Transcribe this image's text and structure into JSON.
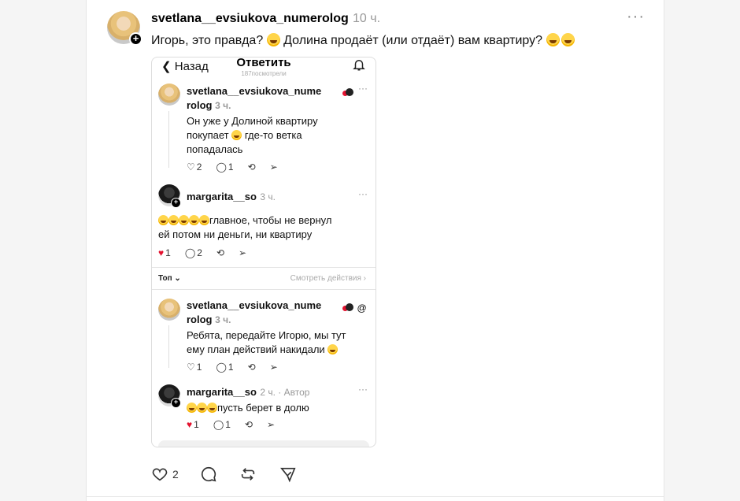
{
  "post": {
    "username": "svetlana__evsiukova_numerolog",
    "time": "10 ч.",
    "text_part1": "Игорь, это правда?",
    "text_part2": "Долина продаёт (или отдаёт) вам квартиру?",
    "like_count": "2"
  },
  "screenshot": {
    "back_label": "Назад",
    "title": "Ответить",
    "views": "187посмотрели",
    "comments": [
      {
        "username": "svetlana__evsiukova_nume",
        "username_cont": "rolog",
        "time": "3 ч.",
        "lines": [
          "Он уже у Долиной квартиру",
          "где-то ветка",
          "попадалась"
        ],
        "line2_prefix": "покупает",
        "likes": "2",
        "replies": "1"
      },
      {
        "username": "margarita__so",
        "time": "3 ч.",
        "line1": "главное, чтобы не вернул",
        "line2": "ей потом ни деньги, ни квартиру",
        "likes": "1",
        "replies": "2"
      },
      {
        "username": "svetlana__evsiukova_nume",
        "username_cont": "rolog",
        "time": "3 ч.",
        "line1": "Ребята, передайте Игорю, мы тут",
        "line2": "ему план действий накидали",
        "likes": "1",
        "replies": "1"
      },
      {
        "username": "margarita__so",
        "time": "2 ч. · Автор",
        "line1": "пусть берет в долю",
        "likes": "1",
        "replies": "1"
      }
    ],
    "sort_label": "Топ",
    "see_activity": "Смотреть действия"
  },
  "colors": {
    "accent_red": "#e4122f",
    "muted": "#999999"
  },
  "icons": [
    "plus-icon",
    "more-icon",
    "heart-icon",
    "comment-icon",
    "repost-icon",
    "share-icon",
    "bell-icon",
    "chevron-left-icon"
  ]
}
